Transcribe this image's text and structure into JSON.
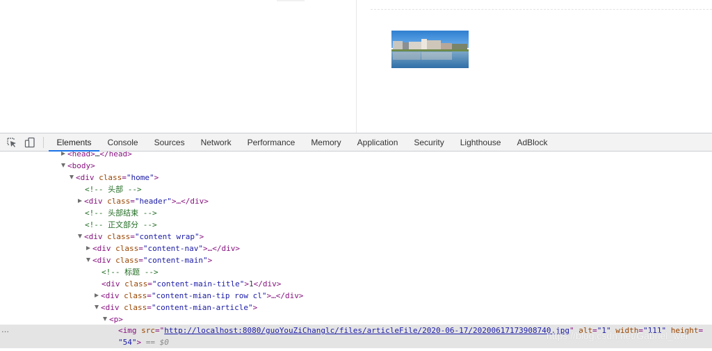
{
  "devtools": {
    "tabs": [
      "Elements",
      "Console",
      "Sources",
      "Network",
      "Performance",
      "Memory",
      "Application",
      "Security",
      "Lighthouse",
      "AdBlock"
    ],
    "active_tab": "Elements",
    "icons": {
      "inspect": "cursor-select-icon",
      "device": "device-toolbar-icon"
    }
  },
  "tree": {
    "head": {
      "open": "<head>",
      "ellipsis": "…",
      "close": "</head>"
    },
    "body": {
      "open": "<body>"
    },
    "home": {
      "open": "<div",
      "attr": "class",
      "value": "\"home\"",
      "end": ">"
    },
    "comment_header": "<!-- 头部 -->",
    "header": {
      "open": "<div",
      "attr": "class",
      "value": "\"header\"",
      "end": ">…</div>"
    },
    "comment_header_end": "<!-- 头部结束 -->",
    "comment_body": "<!-- 正文部分 -->",
    "content": {
      "open": "<div",
      "attr": "class",
      "value": "\"content wrap\"",
      "end": ">"
    },
    "content_nav": {
      "open": "<div",
      "attr": "class",
      "value": "\"content-nav\"",
      "end": ">…</div>"
    },
    "content_main": {
      "open": "<div",
      "attr": "class",
      "value": "\"content-main\"",
      "end": ">"
    },
    "comment_title": "<!-- 标题 -->",
    "main_title": {
      "open": "<div",
      "attr": "class",
      "value": "\"content-main-title\"",
      "mid": ">",
      "text": "1",
      "end": "</div>"
    },
    "mian_tip": {
      "open": "<div",
      "attr": "class",
      "value": "\"content-mian-tip row cl\"",
      "end": ">…</div>"
    },
    "mian_article": {
      "open": "<div",
      "attr": "class",
      "value": "\"content-mian-article\"",
      "end": ">"
    },
    "p": {
      "open": "<p>"
    },
    "img": {
      "open": "<img",
      "src_attr": "src",
      "src": "http://localhost:8080/guoYouZiChanglc/files/articleFile/2020-06-17/20200617173908740.jpg",
      "alt_attr": "alt",
      "alt": "\"1\"",
      "width_attr": "width",
      "width": "\"111\"",
      "height_attr": "height",
      "height": "\"54\"",
      "close": ">",
      "selected_marker": "== $0"
    },
    "more_menu": "…"
  },
  "watermark": "https://blog.csdn.net/Gabriel_wei"
}
